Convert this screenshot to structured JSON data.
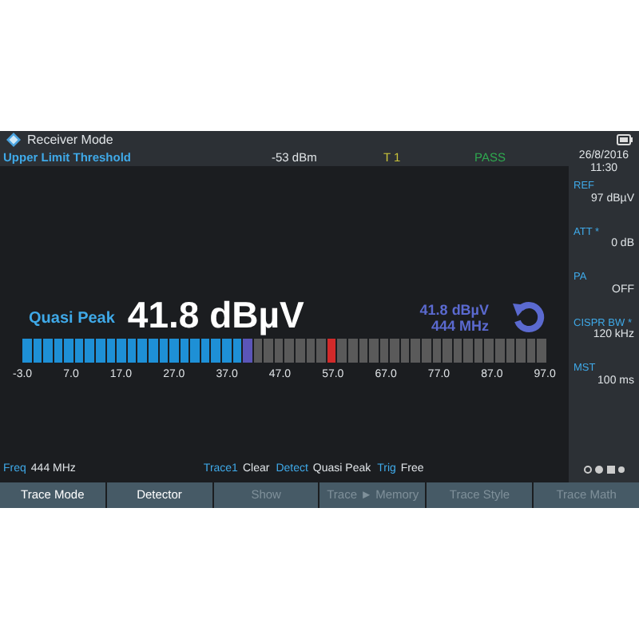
{
  "title_bar": {
    "title": "Receiver Mode"
  },
  "header": {
    "label": "Upper Limit Threshold",
    "threshold": "-53 dBm",
    "trace": "T 1",
    "result": "PASS",
    "date": "26/8/2016",
    "time": "11:30"
  },
  "readout": {
    "detector": "Quasi Peak",
    "value": "41.8 dBµV",
    "marker_value": "41.8 dBµV",
    "marker_freq": "444 MHz"
  },
  "meter": {
    "level": 0.448,
    "limit_marker": {
      "level": 0.58
    },
    "ticks": [
      "-3.0",
      "7.0",
      "17.0",
      "27.0",
      "37.0",
      "47.0",
      "57.0",
      "67.0",
      "77.0",
      "87.0",
      "97.0"
    ]
  },
  "sidebar": [
    {
      "label": "REF",
      "value": "97 dBµV"
    },
    {
      "label": "ATT *",
      "value": "0 dB"
    },
    {
      "label": "PA",
      "value": "OFF"
    },
    {
      "label": "CISPR BW *",
      "value": "120 kHz"
    },
    {
      "label": "MST",
      "value": "100 ms"
    }
  ],
  "status_bar": [
    {
      "label": "Freq",
      "value": "444 MHz"
    },
    {
      "label": "Trace1",
      "value": "Clear"
    },
    {
      "label": "Detect",
      "value": "Quasi Peak"
    },
    {
      "label": "Trig",
      "value": "Free"
    }
  ],
  "softkeys": [
    {
      "label": "Trace Mode",
      "disabled": false
    },
    {
      "label": "Detector",
      "disabled": false
    },
    {
      "label": "Show",
      "disabled": true
    },
    {
      "label": "Trace ► Memory",
      "disabled": true
    },
    {
      "label": "Trace Style",
      "disabled": true
    },
    {
      "label": "Trace Math",
      "disabled": true
    }
  ]
}
